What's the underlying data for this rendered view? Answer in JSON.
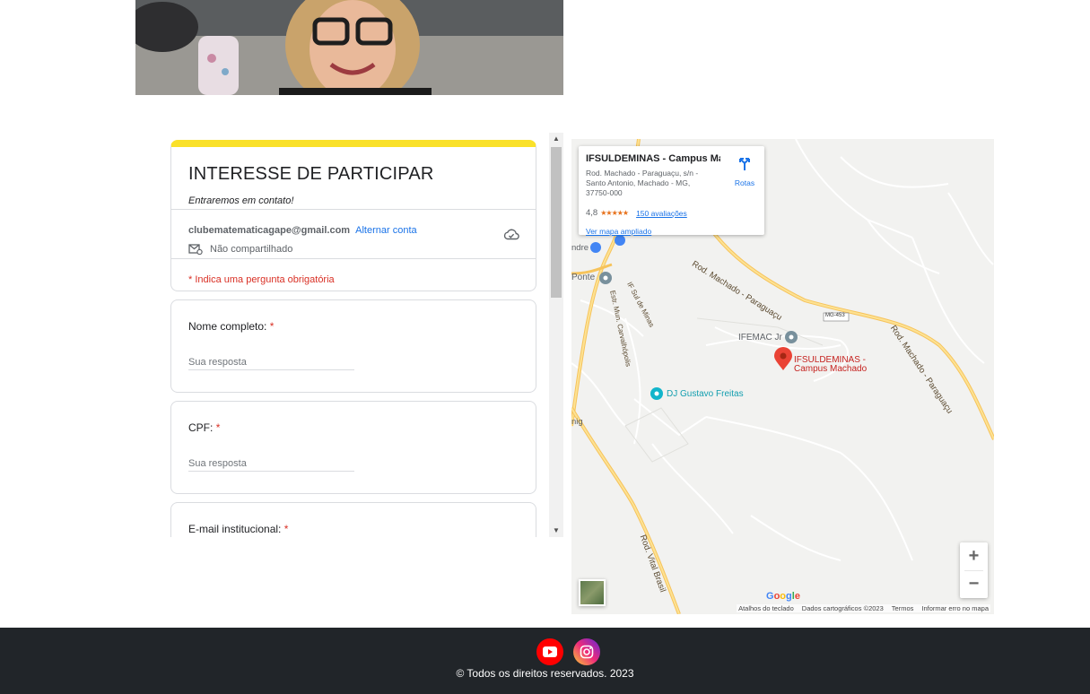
{
  "form": {
    "title": "INTERESSE DE PARTICIPAR",
    "subtitle": "Entraremos em contato!",
    "account_email": "clubematematicagape@gmail.com",
    "switch_account": "Alternar conta",
    "not_shared": "Não compartilhado",
    "required_note": "* Indica uma pergunta obrigatória",
    "questions": [
      {
        "label": "Nome completo:",
        "required_mark": "*",
        "placeholder": "Sua resposta"
      },
      {
        "label": "CPF:",
        "required_mark": "*",
        "placeholder": "Sua resposta"
      },
      {
        "label": "E-mail  institucional:",
        "required_mark": "*"
      }
    ],
    "accent_color": "#fae12a"
  },
  "map": {
    "place_title": "IFSULDEMINAS - Campus Ma...",
    "address": "Rod. Machado - Paraguaçu, s/n - Santo Antonio, Machado - MG, 37750-000",
    "rating": "4,8",
    "stars": "★★★★★",
    "reviews": "150 avaliações",
    "larger_map": "Ver mapa ampliado",
    "directions": "Rotas",
    "labels": {
      "campus_line1": "IFSULDEMINAS -",
      "campus_line2": "Campus Machado",
      "ifemac": "IFEMAC Jr",
      "dj": "DJ Gustavo Freitas",
      "road1": "Rod. Machado - Paraguaçu",
      "road2": "Rod. Machado - Paraguaçu",
      "road3": "Rod. Vital Brasil",
      "road4": "Estr. Mun. Carvalhópolis",
      "road5": "IF Sul de Minas",
      "mg453": "MG-453",
      "ponte": "Ponte",
      "ndre": "ndre",
      "nig": "nig"
    },
    "zoom_in": "+",
    "zoom_out": "−",
    "google": "Google",
    "attribution": [
      "Atalhos do teclado",
      "Dados cartográficos ©2023",
      "Termos",
      "Informar erro no mapa"
    ]
  },
  "footer": {
    "copyright": "© Todos os direitos reservados. 2023"
  }
}
